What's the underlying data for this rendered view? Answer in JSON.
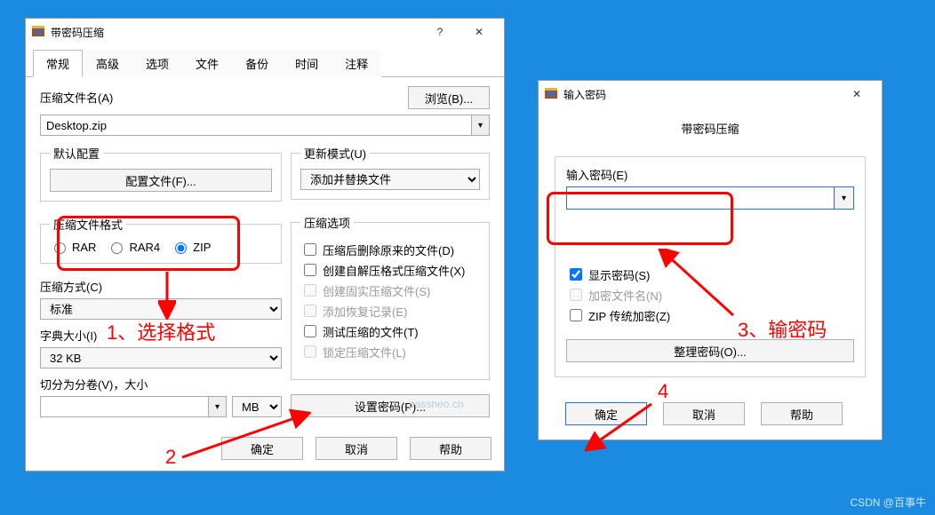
{
  "win1": {
    "title": "带密码压缩",
    "tabs": [
      "常规",
      "高级",
      "选项",
      "文件",
      "备份",
      "时间",
      "注释"
    ],
    "active_tab": 0,
    "filename_label": "压缩文件名(A)",
    "filename_value": "Desktop.zip",
    "browse_btn": "浏览(B)...",
    "default_profile": {
      "legend": "默认配置",
      "profile_btn": "配置文件(F)..."
    },
    "update_mode": {
      "legend": "更新模式(U)",
      "value": "添加并替换文件"
    },
    "format": {
      "legend": "压缩文件格式",
      "options": [
        "RAR",
        "RAR4",
        "ZIP"
      ],
      "selected": "ZIP"
    },
    "compress_opts": {
      "legend": "压缩选项",
      "items": [
        {
          "label": "压缩后删除原来的文件(D)",
          "checked": false,
          "enabled": true
        },
        {
          "label": "创建自解压格式压缩文件(X)",
          "checked": false,
          "enabled": true
        },
        {
          "label": "创建固实压缩文件(S)",
          "checked": false,
          "enabled": false
        },
        {
          "label": "添加恢复记录(E)",
          "checked": false,
          "enabled": false
        },
        {
          "label": "测试压缩的文件(T)",
          "checked": false,
          "enabled": true
        },
        {
          "label": "锁定压缩文件(L)",
          "checked": false,
          "enabled": false
        }
      ]
    },
    "method": {
      "label": "压缩方式(C)",
      "value": "标准"
    },
    "dict": {
      "label": "字典大小(I)",
      "value": "32 KB"
    },
    "split": {
      "label": "切分为分卷(V)，大小",
      "unit": "MB"
    },
    "set_password_btn": "设置密码(P)...",
    "ok": "确定",
    "cancel": "取消",
    "help": "帮助"
  },
  "win2": {
    "title": "输入密码",
    "header": "带密码压缩",
    "pw_label": "输入密码(E)",
    "pw_value": "",
    "show_pw": {
      "label": "显示密码(S)",
      "checked": true
    },
    "enc_name": {
      "label": "加密文件名(N)",
      "checked": false,
      "enabled": false
    },
    "zip_legacy": {
      "label": "ZIP 传统加密(Z)",
      "checked": false
    },
    "manage_btn": "整理密码(O)...",
    "ok": "确定",
    "cancel": "取消",
    "help": "帮助"
  },
  "annotations": {
    "a1": "1、选择格式",
    "a2": "2",
    "a3": "3、输密码",
    "a4": "4"
  },
  "watermark": "passneo.cn",
  "credit": "CSDN @百事牛"
}
